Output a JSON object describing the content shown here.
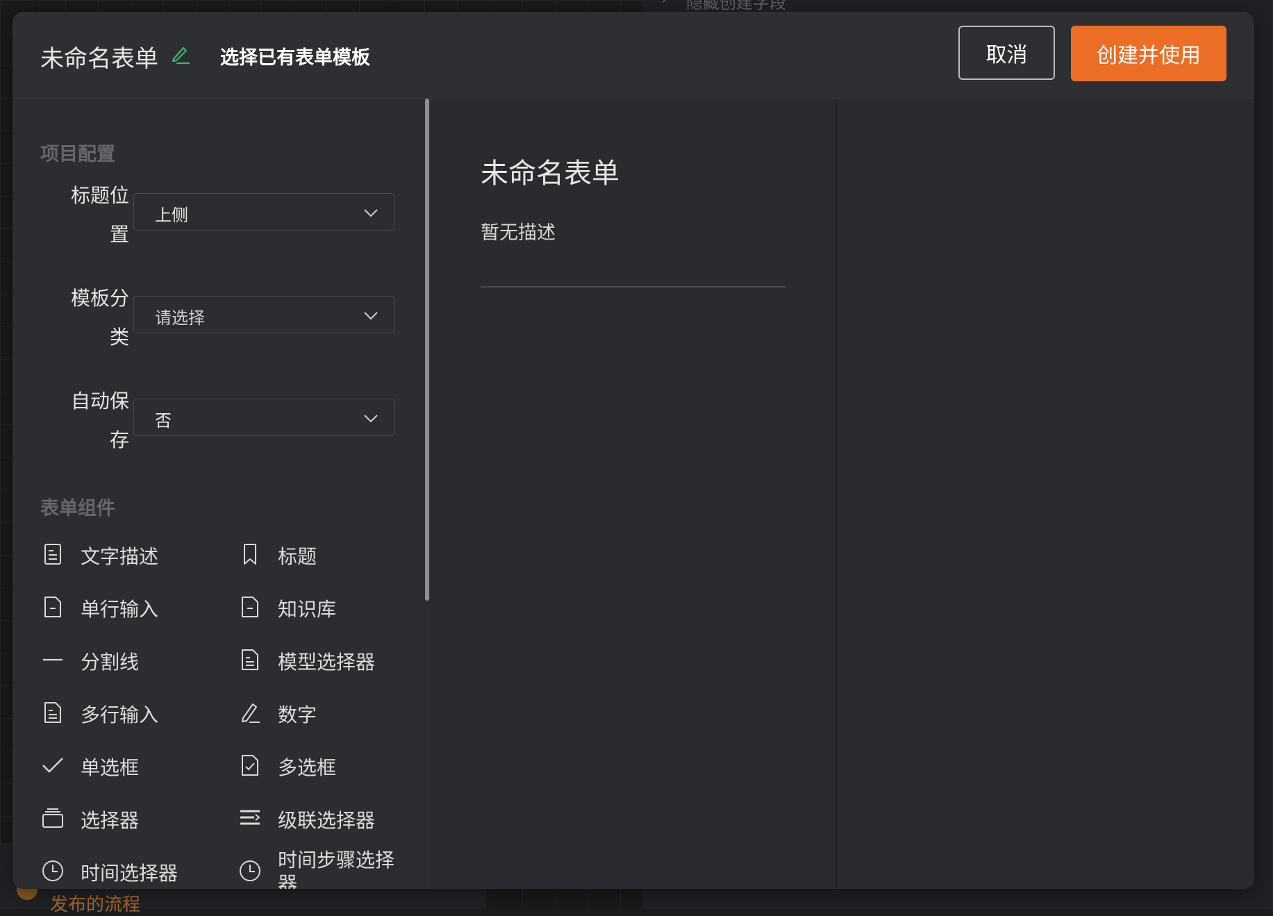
{
  "background": {
    "top_item": "隐藏创建字段",
    "bottom_item": "发布的流程"
  },
  "header": {
    "form_title": "未命名表单",
    "template_link": "选择已有表单模板",
    "cancel_label": "取消",
    "create_label": "创建并使用"
  },
  "config": {
    "section_title": "项目配置",
    "fields": [
      {
        "label_line1": "标题位",
        "label_line2": "置",
        "value": "上侧"
      },
      {
        "label_line1": "模板分",
        "label_line2": "类",
        "value": "请选择"
      },
      {
        "label_line1": "自动保",
        "label_line2": "存",
        "value": "否"
      }
    ]
  },
  "components": {
    "section_title": "表单组件",
    "items": [
      {
        "label": "文字描述",
        "icon": "document-lines-icon"
      },
      {
        "label": "标题",
        "icon": "bookmark-icon"
      },
      {
        "label": "单行输入",
        "icon": "document-minus-icon"
      },
      {
        "label": "知识库",
        "icon": "document-minus-icon"
      },
      {
        "label": "分割线",
        "icon": "horizontal-line-icon"
      },
      {
        "label": "模型选择器",
        "icon": "document-lines-icon"
      },
      {
        "label": "多行输入",
        "icon": "document-text-icon"
      },
      {
        "label": "数字",
        "icon": "pencil-icon"
      },
      {
        "label": "单选框",
        "icon": "check-icon"
      },
      {
        "label": "多选框",
        "icon": "document-check-icon"
      },
      {
        "label": "选择器",
        "icon": "stack-icon"
      },
      {
        "label": "级联选择器",
        "icon": "list-icon"
      },
      {
        "label": "时间选择器",
        "icon": "clock-icon"
      },
      {
        "label": "时间步骤选择器",
        "icon": "clock-icon"
      }
    ]
  },
  "preview": {
    "title": "未命名表单",
    "description": "暂无描述"
  },
  "colors": {
    "accent": "#ec6d25",
    "edit_icon": "#3fb36b",
    "panel": "#2c2d31"
  }
}
